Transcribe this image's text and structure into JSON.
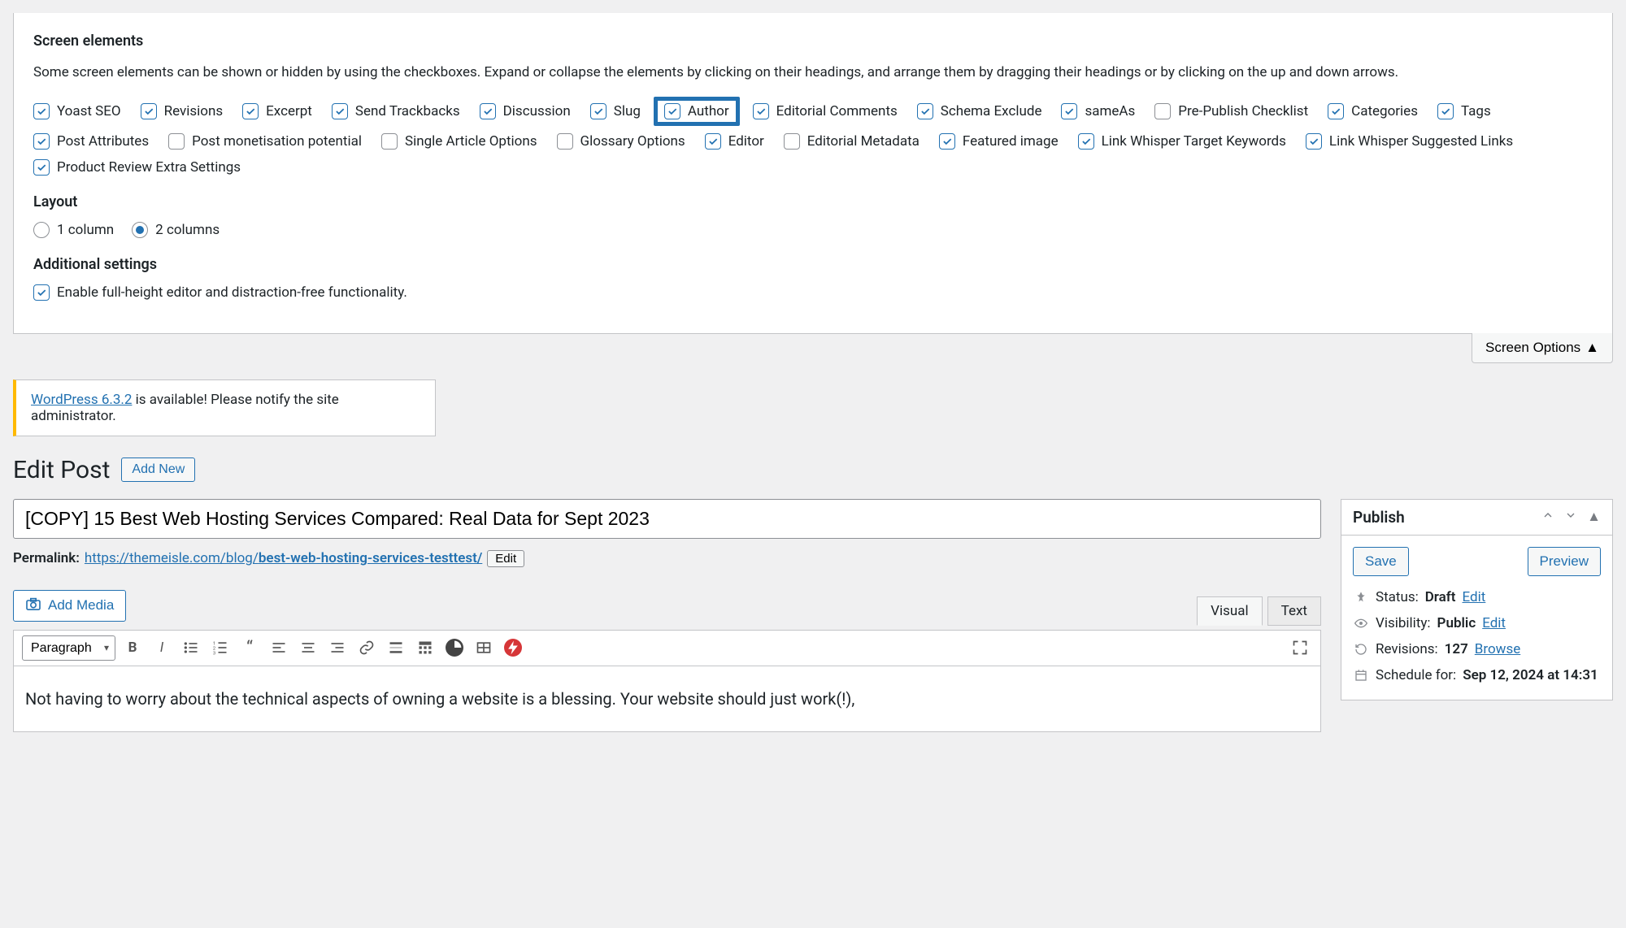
{
  "screen_elements": {
    "heading": "Screen elements",
    "description": "Some screen elements can be shown or hidden by using the checkboxes. Expand or collapse the elements by clicking on their headings, and arrange them by dragging their headings or by clicking on the up and down arrows.",
    "boxes": [
      {
        "label": "Yoast SEO",
        "checked": true
      },
      {
        "label": "Revisions",
        "checked": true
      },
      {
        "label": "Excerpt",
        "checked": true
      },
      {
        "label": "Send Trackbacks",
        "checked": true
      },
      {
        "label": "Discussion",
        "checked": true
      },
      {
        "label": "Slug",
        "checked": true
      },
      {
        "label": "Author",
        "checked": true,
        "highlight": true
      },
      {
        "label": "Editorial Comments",
        "checked": true
      },
      {
        "label": "Schema Exclude",
        "checked": true
      },
      {
        "label": "sameAs",
        "checked": true
      },
      {
        "label": "Pre-Publish Checklist",
        "checked": false
      },
      {
        "label": "Categories",
        "checked": true
      },
      {
        "label": "Tags",
        "checked": true
      },
      {
        "label": "Post Attributes",
        "checked": true
      },
      {
        "label": "Post monetisation potential",
        "checked": false
      },
      {
        "label": "Single Article Options",
        "checked": false
      },
      {
        "label": "Glossary Options",
        "checked": false
      },
      {
        "label": "Editor",
        "checked": true
      },
      {
        "label": "Editorial Metadata",
        "checked": false
      },
      {
        "label": "Featured image",
        "checked": true
      },
      {
        "label": "Link Whisper Target Keywords",
        "checked": true
      },
      {
        "label": "Link Whisper Suggested Links",
        "checked": true
      },
      {
        "label": "Product Review Extra Settings",
        "checked": true
      }
    ]
  },
  "layout": {
    "heading": "Layout",
    "options": [
      "1 column",
      "2 columns"
    ],
    "selected": "2 columns"
  },
  "additional": {
    "heading": "Additional settings",
    "enable_label": "Enable full-height editor and distraction-free functionality.",
    "enable_checked": true
  },
  "screen_options_btn": "Screen Options",
  "notice": {
    "link_text": "WordPress 6.3.2",
    "rest": " is available! Please notify the site administrator."
  },
  "page": {
    "title": "Edit Post",
    "add_new": "Add New"
  },
  "post": {
    "title_value": "[COPY] 15 Best Web Hosting Services Compared: Real Data for Sept 2023",
    "permalink_label": "Permalink:",
    "permalink_base": "https://themeisle.com/blog/",
    "permalink_slug": "best-web-hosting-services-testtest/",
    "permalink_edit": "Edit",
    "add_media": "Add Media",
    "paragraph_label": "Paragraph",
    "tabs": {
      "visual": "Visual",
      "text": "Text"
    },
    "body": "Not having to worry about the technical aspects of owning a website is a blessing. Your website should just work(!),"
  },
  "publish": {
    "title": "Publish",
    "save": "Save",
    "preview": "Preview",
    "status_label": "Status:",
    "status_value": "Draft",
    "status_edit": "Edit",
    "visibility_label": "Visibility:",
    "visibility_value": "Public",
    "visibility_edit": "Edit",
    "revisions_label": "Revisions:",
    "revisions_value": "127",
    "revisions_browse": "Browse",
    "schedule_label": "Schedule for:",
    "schedule_value": "Sep 12, 2024 at 14:31"
  }
}
